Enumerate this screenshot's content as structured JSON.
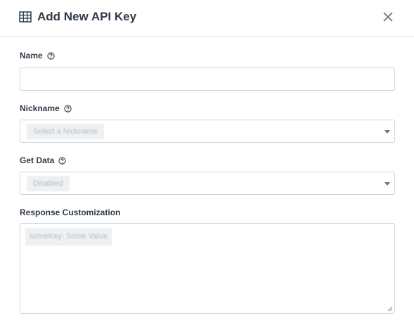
{
  "dialog": {
    "title": "Add New API Key",
    "title_icon": "grid-icon",
    "close_icon": "close-icon"
  },
  "form": {
    "name": {
      "label": "Name",
      "value": "",
      "help_icon": "question-circle-icon"
    },
    "nickname": {
      "label": "Nickname",
      "selected": "Select a Nickname",
      "help_icon": "question-circle-icon"
    },
    "get_data": {
      "label": "Get Data",
      "selected": "Disabled",
      "help_icon": "question-circle-icon"
    },
    "response_customization": {
      "label": "Response Customization",
      "placeholder": "someKey: Some Value"
    }
  },
  "colors": {
    "text": "#2f3a48",
    "border": "#cfd5dc",
    "divider": "#e3e6ea"
  }
}
